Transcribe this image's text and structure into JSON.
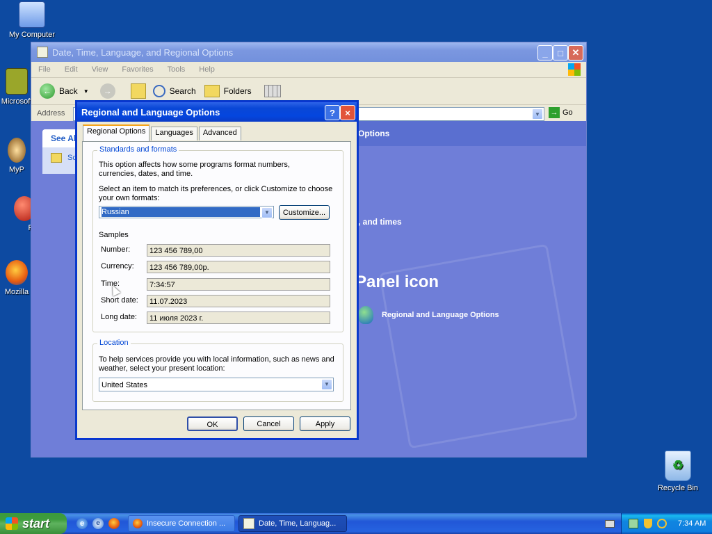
{
  "desktop": {
    "icons": [
      {
        "label": "My Computer"
      },
      {
        "label": "Microsoft"
      },
      {
        "label": "MyP"
      },
      {
        "label": "Pe"
      },
      {
        "label": "Mozilla"
      },
      {
        "label": "Recycle Bin"
      }
    ]
  },
  "explorer": {
    "title": "Date, Time, Language, and Regional Options",
    "menu": [
      "File",
      "Edit",
      "View",
      "Favorites",
      "Tools",
      "Help"
    ],
    "toolbar": {
      "back": "Back",
      "search": "Search",
      "folders": "Folders"
    },
    "address_label": "Address",
    "go_label": "Go",
    "side_header": "See Al",
    "side_item": "Sch",
    "content": {
      "fragment_options": "Options",
      "fragment_times": ", and times",
      "fragment_panel_icon": "Panel icon",
      "regional_link": "Regional and Language Options"
    }
  },
  "dialog": {
    "title": "Regional and Language Options",
    "help_glyph": "?",
    "close_glyph": "×",
    "tabs": [
      "Regional Options",
      "Languages",
      "Advanced"
    ],
    "standards": {
      "label": "Standards and formats",
      "description": "This option affects how some programs format numbers, currencies, dates, and time.",
      "select_prompt": "Select an item to match its preferences, or click Customize to choose your own formats:",
      "selected_format": "Russian",
      "customize_button": "Customize...",
      "samples_label": "Samples",
      "samples": [
        {
          "label": "Number:",
          "value": "123 456 789,00"
        },
        {
          "label": "Currency:",
          "value": "123 456 789,00р."
        },
        {
          "label": "Time:",
          "value": "7:34:57"
        },
        {
          "label": "Short date:",
          "value": "11.07.2023"
        },
        {
          "label": "Long date:",
          "value": "11 июля 2023 г."
        }
      ]
    },
    "location": {
      "label": "Location",
      "description": "To help services provide you with local information, such as news and weather, select your present location:",
      "selected": "United States"
    },
    "buttons": {
      "ok": "OK",
      "cancel": "Cancel",
      "apply": "Apply"
    }
  },
  "taskbar": {
    "start_label": "start",
    "tasks": [
      {
        "label": "Insecure Connection ..."
      },
      {
        "label": "Date, Time, Languag..."
      }
    ],
    "clock": "7:34 AM"
  },
  "colors": {
    "desktop_bg": "#0d4aa1",
    "dialog_title": "#0446de",
    "group_label": "#0046d5",
    "selection": "#316ac5"
  }
}
